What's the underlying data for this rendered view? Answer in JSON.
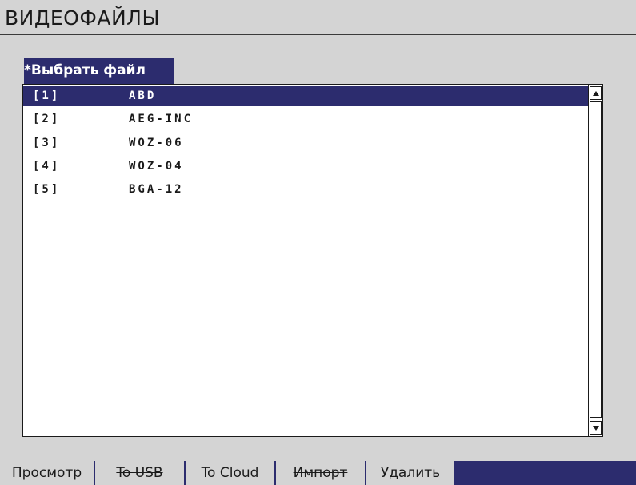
{
  "header": {
    "title": "ВИДЕОФАЙЛЫ"
  },
  "tab": {
    "label": "*Выбрать файл"
  },
  "files": [
    {
      "index": "[1]",
      "name": "ABD",
      "selected": true
    },
    {
      "index": "[2]",
      "name": "AEG-INC",
      "selected": false
    },
    {
      "index": "[3]",
      "name": "WOZ-06",
      "selected": false
    },
    {
      "index": "[4]",
      "name": "WOZ-04",
      "selected": false
    },
    {
      "index": "[5]",
      "name": "BGA-12",
      "selected": false
    }
  ],
  "softkeys": [
    {
      "label": "Просмотр",
      "enabled": true
    },
    {
      "label": "To USB",
      "enabled": false
    },
    {
      "label": "To Cloud",
      "enabled": true
    },
    {
      "label": "Импорт",
      "enabled": false
    },
    {
      "label": "Удалить",
      "enabled": true
    }
  ],
  "colors": {
    "accent": "#2c2c6e",
    "panel": "#d4d4d4",
    "list_bg": "#ffffff"
  },
  "icons": {
    "scroll_up": "triangle-up-icon",
    "scroll_down": "triangle-down-icon"
  }
}
